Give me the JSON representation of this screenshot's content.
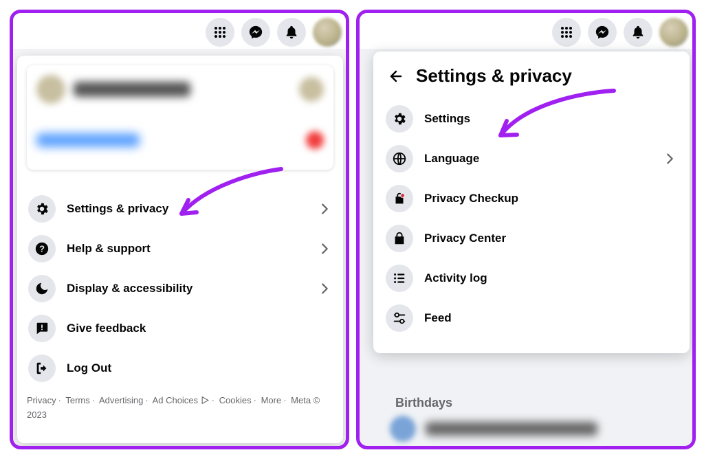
{
  "left": {
    "menu": [
      {
        "label": "Settings & privacy",
        "chevron": true,
        "icon": "gear-icon"
      },
      {
        "label": "Help & support",
        "chevron": true,
        "icon": "help-icon"
      },
      {
        "label": "Display & accessibility",
        "chevron": true,
        "icon": "moon-icon"
      },
      {
        "label": "Give feedback",
        "chevron": false,
        "icon": "feedback-icon"
      },
      {
        "label": "Log Out",
        "chevron": false,
        "icon": "logout-icon"
      }
    ],
    "footer": {
      "privacy": "Privacy",
      "terms": "Terms",
      "advertising": "Advertising",
      "ad_choices": "Ad Choices",
      "cookies": "Cookies",
      "more": "More",
      "meta": "Meta © 2023"
    }
  },
  "right": {
    "title": "Settings & privacy",
    "bg_section": "Birthdays",
    "items": [
      {
        "label": "Settings",
        "chevron": false,
        "icon": "gear-icon"
      },
      {
        "label": "Language",
        "chevron": true,
        "icon": "globe-icon"
      },
      {
        "label": "Privacy Checkup",
        "chevron": false,
        "icon": "privacy-checkup-icon"
      },
      {
        "label": "Privacy Center",
        "chevron": false,
        "icon": "lock-icon"
      },
      {
        "label": "Activity log",
        "chevron": false,
        "icon": "activity-log-icon"
      },
      {
        "label": "Feed",
        "chevron": false,
        "icon": "feed-sliders-icon"
      }
    ]
  },
  "colors": {
    "accent": "#a020f0"
  }
}
